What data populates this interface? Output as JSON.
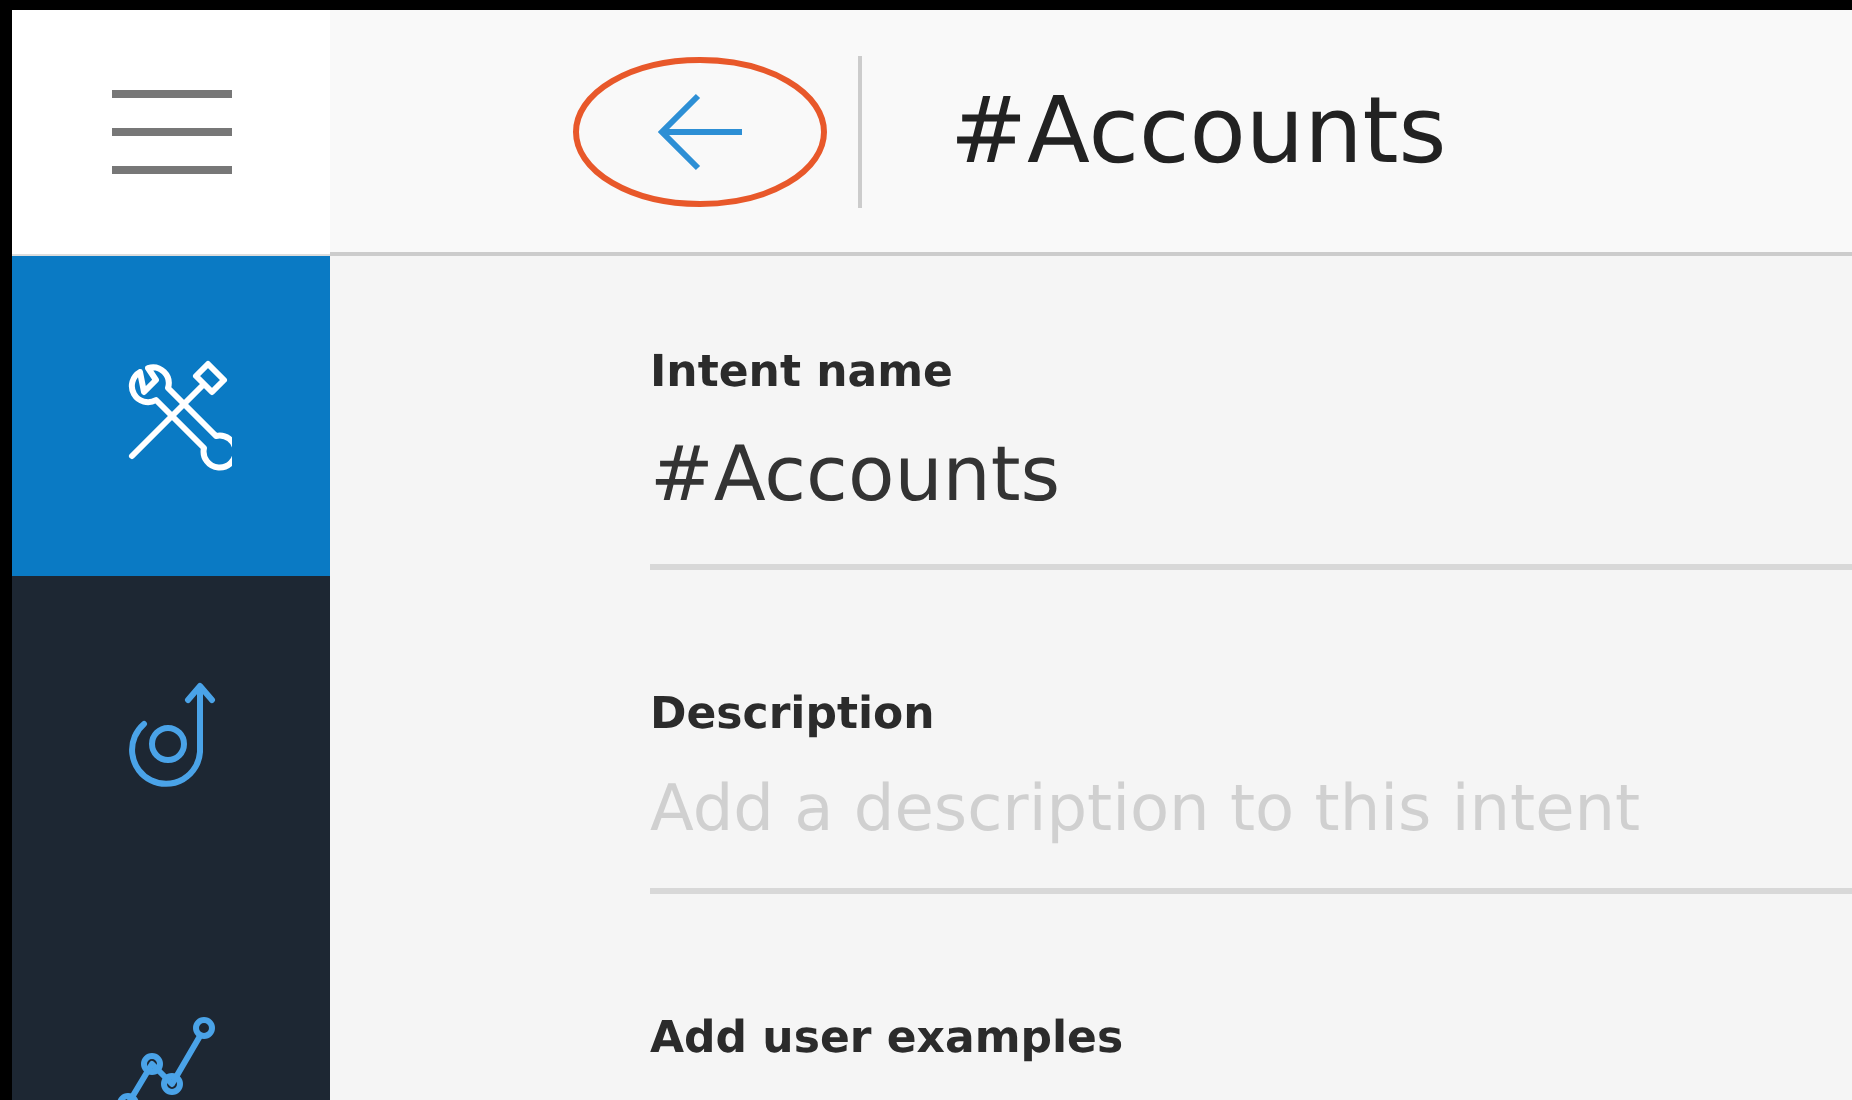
{
  "header": {
    "title": "#Accounts"
  },
  "sidebar": {
    "items": [
      {
        "kind": "tools",
        "selected": true
      },
      {
        "kind": "dialog",
        "selected": false
      },
      {
        "kind": "analytics",
        "selected": false
      }
    ]
  },
  "form": {
    "fields": [
      {
        "label": "Intent name",
        "value": "#Accounts"
      },
      {
        "label": "Description",
        "placeholder": "Add a description to this intent"
      }
    ],
    "next_section": "Add user examples"
  }
}
